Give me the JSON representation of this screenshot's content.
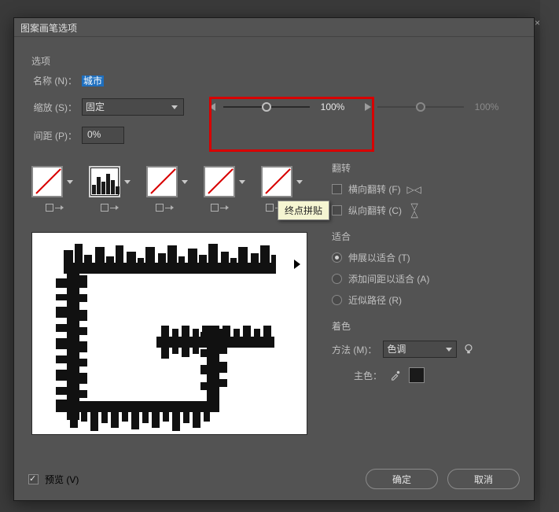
{
  "dialog": {
    "title": "图案画笔选项"
  },
  "options": {
    "section": "选项",
    "name_label": "名称 (N)：",
    "name_value": "城市",
    "scale_label": "缩放 (S)：",
    "scale_mode": "固定",
    "scale_value": "100%",
    "scale2_value": "100%",
    "spacing_label": "间距 (P)：",
    "spacing_value": "0%"
  },
  "tooltip": "终点拼贴",
  "flip": {
    "section": "翻转",
    "h_label": "横向翻转 (F)",
    "v_label": "纵向翻转 (C)"
  },
  "fit": {
    "section": "适合",
    "stretch": "伸展以适合 (T)",
    "space": "添加间距以适合 (A)",
    "approx": "近似路径 (R)"
  },
  "color": {
    "section": "着色",
    "method_label": "方法 (M)：",
    "method_value": "色调",
    "key_label": "主色："
  },
  "footer": {
    "preview": "预览 (V)",
    "ok": "确定",
    "cancel": "取消"
  }
}
